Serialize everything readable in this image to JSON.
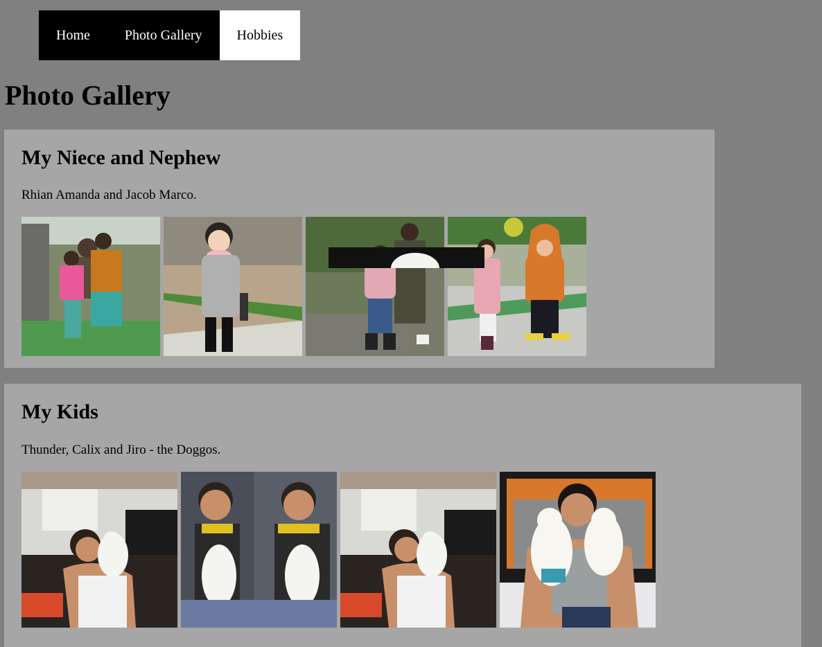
{
  "nav": {
    "items": [
      {
        "label": "Home"
      },
      {
        "label": "Photo Gallery"
      },
      {
        "label": "Hobbies"
      }
    ]
  },
  "page": {
    "title": "Photo Gallery"
  },
  "sections": [
    {
      "heading": "My Niece and Nephew",
      "caption": "Rhian Amanda and Jacob Marco."
    },
    {
      "heading": "My Kids",
      "caption": "Thunder, Calix and Jiro - the Doggos."
    }
  ]
}
